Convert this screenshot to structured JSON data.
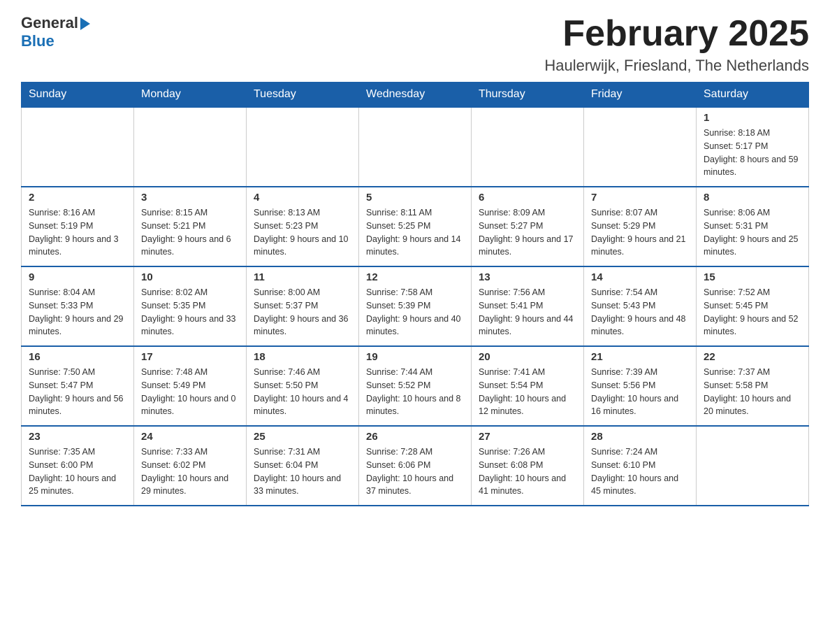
{
  "header": {
    "logo_general": "General",
    "logo_blue": "Blue",
    "month_title": "February 2025",
    "location": "Haulerwijk, Friesland, The Netherlands"
  },
  "weekdays": [
    "Sunday",
    "Monday",
    "Tuesday",
    "Wednesday",
    "Thursday",
    "Friday",
    "Saturday"
  ],
  "weeks": [
    [
      {
        "day": "",
        "sunrise": "",
        "sunset": "",
        "daylight": ""
      },
      {
        "day": "",
        "sunrise": "",
        "sunset": "",
        "daylight": ""
      },
      {
        "day": "",
        "sunrise": "",
        "sunset": "",
        "daylight": ""
      },
      {
        "day": "",
        "sunrise": "",
        "sunset": "",
        "daylight": ""
      },
      {
        "day": "",
        "sunrise": "",
        "sunset": "",
        "daylight": ""
      },
      {
        "day": "",
        "sunrise": "",
        "sunset": "",
        "daylight": ""
      },
      {
        "day": "1",
        "sunrise": "Sunrise: 8:18 AM",
        "sunset": "Sunset: 5:17 PM",
        "daylight": "Daylight: 8 hours and 59 minutes."
      }
    ],
    [
      {
        "day": "2",
        "sunrise": "Sunrise: 8:16 AM",
        "sunset": "Sunset: 5:19 PM",
        "daylight": "Daylight: 9 hours and 3 minutes."
      },
      {
        "day": "3",
        "sunrise": "Sunrise: 8:15 AM",
        "sunset": "Sunset: 5:21 PM",
        "daylight": "Daylight: 9 hours and 6 minutes."
      },
      {
        "day": "4",
        "sunrise": "Sunrise: 8:13 AM",
        "sunset": "Sunset: 5:23 PM",
        "daylight": "Daylight: 9 hours and 10 minutes."
      },
      {
        "day": "5",
        "sunrise": "Sunrise: 8:11 AM",
        "sunset": "Sunset: 5:25 PM",
        "daylight": "Daylight: 9 hours and 14 minutes."
      },
      {
        "day": "6",
        "sunrise": "Sunrise: 8:09 AM",
        "sunset": "Sunset: 5:27 PM",
        "daylight": "Daylight: 9 hours and 17 minutes."
      },
      {
        "day": "7",
        "sunrise": "Sunrise: 8:07 AM",
        "sunset": "Sunset: 5:29 PM",
        "daylight": "Daylight: 9 hours and 21 minutes."
      },
      {
        "day": "8",
        "sunrise": "Sunrise: 8:06 AM",
        "sunset": "Sunset: 5:31 PM",
        "daylight": "Daylight: 9 hours and 25 minutes."
      }
    ],
    [
      {
        "day": "9",
        "sunrise": "Sunrise: 8:04 AM",
        "sunset": "Sunset: 5:33 PM",
        "daylight": "Daylight: 9 hours and 29 minutes."
      },
      {
        "day": "10",
        "sunrise": "Sunrise: 8:02 AM",
        "sunset": "Sunset: 5:35 PM",
        "daylight": "Daylight: 9 hours and 33 minutes."
      },
      {
        "day": "11",
        "sunrise": "Sunrise: 8:00 AM",
        "sunset": "Sunset: 5:37 PM",
        "daylight": "Daylight: 9 hours and 36 minutes."
      },
      {
        "day": "12",
        "sunrise": "Sunrise: 7:58 AM",
        "sunset": "Sunset: 5:39 PM",
        "daylight": "Daylight: 9 hours and 40 minutes."
      },
      {
        "day": "13",
        "sunrise": "Sunrise: 7:56 AM",
        "sunset": "Sunset: 5:41 PM",
        "daylight": "Daylight: 9 hours and 44 minutes."
      },
      {
        "day": "14",
        "sunrise": "Sunrise: 7:54 AM",
        "sunset": "Sunset: 5:43 PM",
        "daylight": "Daylight: 9 hours and 48 minutes."
      },
      {
        "day": "15",
        "sunrise": "Sunrise: 7:52 AM",
        "sunset": "Sunset: 5:45 PM",
        "daylight": "Daylight: 9 hours and 52 minutes."
      }
    ],
    [
      {
        "day": "16",
        "sunrise": "Sunrise: 7:50 AM",
        "sunset": "Sunset: 5:47 PM",
        "daylight": "Daylight: 9 hours and 56 minutes."
      },
      {
        "day": "17",
        "sunrise": "Sunrise: 7:48 AM",
        "sunset": "Sunset: 5:49 PM",
        "daylight": "Daylight: 10 hours and 0 minutes."
      },
      {
        "day": "18",
        "sunrise": "Sunrise: 7:46 AM",
        "sunset": "Sunset: 5:50 PM",
        "daylight": "Daylight: 10 hours and 4 minutes."
      },
      {
        "day": "19",
        "sunrise": "Sunrise: 7:44 AM",
        "sunset": "Sunset: 5:52 PM",
        "daylight": "Daylight: 10 hours and 8 minutes."
      },
      {
        "day": "20",
        "sunrise": "Sunrise: 7:41 AM",
        "sunset": "Sunset: 5:54 PM",
        "daylight": "Daylight: 10 hours and 12 minutes."
      },
      {
        "day": "21",
        "sunrise": "Sunrise: 7:39 AM",
        "sunset": "Sunset: 5:56 PM",
        "daylight": "Daylight: 10 hours and 16 minutes."
      },
      {
        "day": "22",
        "sunrise": "Sunrise: 7:37 AM",
        "sunset": "Sunset: 5:58 PM",
        "daylight": "Daylight: 10 hours and 20 minutes."
      }
    ],
    [
      {
        "day": "23",
        "sunrise": "Sunrise: 7:35 AM",
        "sunset": "Sunset: 6:00 PM",
        "daylight": "Daylight: 10 hours and 25 minutes."
      },
      {
        "day": "24",
        "sunrise": "Sunrise: 7:33 AM",
        "sunset": "Sunset: 6:02 PM",
        "daylight": "Daylight: 10 hours and 29 minutes."
      },
      {
        "day": "25",
        "sunrise": "Sunrise: 7:31 AM",
        "sunset": "Sunset: 6:04 PM",
        "daylight": "Daylight: 10 hours and 33 minutes."
      },
      {
        "day": "26",
        "sunrise": "Sunrise: 7:28 AM",
        "sunset": "Sunset: 6:06 PM",
        "daylight": "Daylight: 10 hours and 37 minutes."
      },
      {
        "day": "27",
        "sunrise": "Sunrise: 7:26 AM",
        "sunset": "Sunset: 6:08 PM",
        "daylight": "Daylight: 10 hours and 41 minutes."
      },
      {
        "day": "28",
        "sunrise": "Sunrise: 7:24 AM",
        "sunset": "Sunset: 6:10 PM",
        "daylight": "Daylight: 10 hours and 45 minutes."
      },
      {
        "day": "",
        "sunrise": "",
        "sunset": "",
        "daylight": ""
      }
    ]
  ]
}
